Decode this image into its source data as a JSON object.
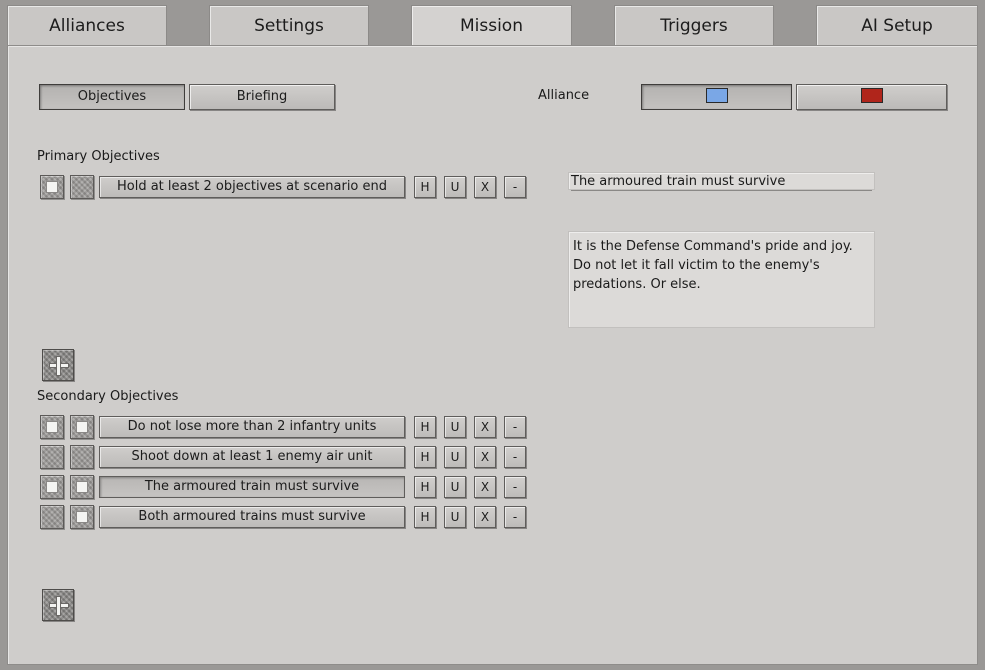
{
  "tabs": [
    {
      "label": "Alliances"
    },
    {
      "label": "Settings"
    },
    {
      "label": "Mission"
    },
    {
      "label": "Triggers"
    },
    {
      "label": "AI Setup"
    }
  ],
  "active_tab": "Mission",
  "subtabs": {
    "objectives_label": "Objectives",
    "briefing_label": "Briefing"
  },
  "alliance": {
    "label": "Alliance",
    "colors": [
      "#7aa7e6",
      "#b0251b"
    ]
  },
  "primary": {
    "heading": "Primary Objectives",
    "items": [
      {
        "text": "Hold at least 2 objectives at scenario end",
        "h": "H",
        "u": "U",
        "x": "X",
        "remove": "-"
      }
    ]
  },
  "secondary": {
    "heading": "Secondary Objectives",
    "items": [
      {
        "text": "Do not lose more than 2 infantry units",
        "h": "H",
        "u": "U",
        "x": "X",
        "remove": "-"
      },
      {
        "text": "Shoot down at least 1 enemy air unit",
        "h": "H",
        "u": "U",
        "x": "X",
        "remove": "-"
      },
      {
        "text": "The armoured train must survive",
        "h": "H",
        "u": "U",
        "x": "X",
        "remove": "-"
      },
      {
        "text": "Both armoured trains must survive",
        "h": "H",
        "u": "U",
        "x": "X",
        "remove": "-"
      }
    ]
  },
  "detail": {
    "title_value": "The armoured train must survive",
    "description": "It is the Defense Command's pride and joy. Do not let it fall victim to the enemy's predations. Or else."
  }
}
